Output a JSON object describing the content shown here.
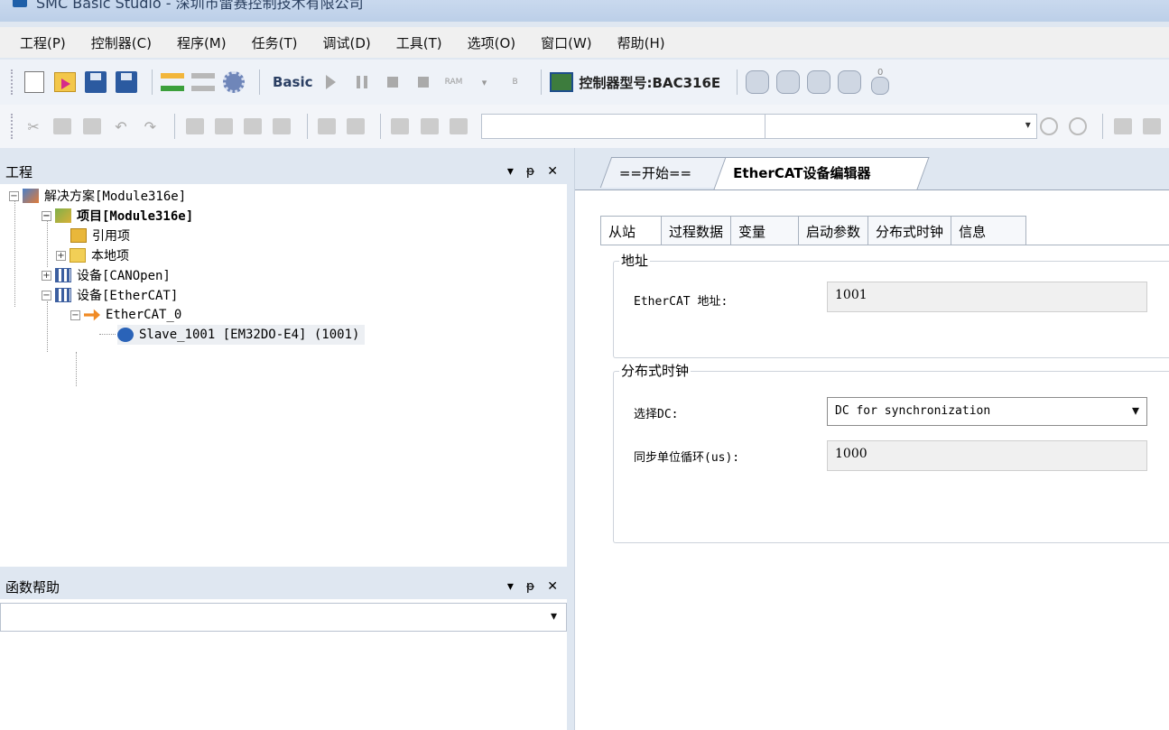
{
  "titlebar": {
    "title": "SMC Basic Studio - 深圳市雷赛控制技术有限公司"
  },
  "menu": [
    "工程(P)",
    "控制器(C)",
    "程序(M)",
    "任务(T)",
    "调试(D)",
    "工具(T)",
    "选项(O)",
    "窗口(W)",
    "帮助(H)"
  ],
  "toolbar": {
    "basic_label": "Basic",
    "ram_label": "RAM",
    "b_label": "B",
    "controller_type": "控制器型号:BAC316E",
    "db_badge": "0"
  },
  "project_panel": {
    "title": "工程",
    "pin": "ᵽ",
    "close": "✕",
    "tree": {
      "solution": "解决方案[Module316e]",
      "project": "项目[Module316e]",
      "references": "引用项",
      "local": "本地项",
      "device_canopen": "设备[CANOpen]",
      "device_ethercat": "设备[EtherCAT]",
      "ethercat_0": "EtherCAT_0",
      "slave": "Slave_1001 [EM32DO-E4] (1001)"
    }
  },
  "help_panel": {
    "title": "函数帮助",
    "pin": "ᵽ",
    "close": "✕"
  },
  "doc_tabs": {
    "start": "==开始==",
    "editor": "EtherCAT设备编辑器"
  },
  "inner_tabs": [
    "从站",
    "过程数据",
    "变量",
    "启动参数",
    "分布式时钟",
    "信息"
  ],
  "address_group": {
    "title": "地址",
    "label": "EtherCAT 地址:",
    "value": "1001"
  },
  "dc_group": {
    "title": "分布式时钟",
    "select_label": "选择DC:",
    "select_value": "DC for synchronization",
    "cycle_label": "同步单位循环(us):",
    "cycle_value": "1000"
  }
}
